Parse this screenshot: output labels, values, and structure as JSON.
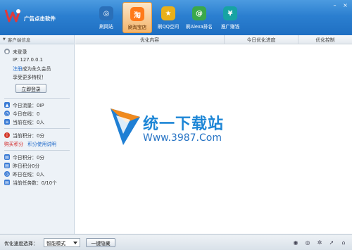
{
  "app": {
    "title": "广告点击软件"
  },
  "nav": [
    {
      "label": "刷网站",
      "icon": "globe-icon",
      "color": "#2a6fb8",
      "glyph": "◎"
    },
    {
      "label": "刷淘宝店",
      "icon": "taobao-icon",
      "color": "#ff7a1a",
      "glyph": "淘"
    },
    {
      "label": "刷QQ空间",
      "icon": "star-icon",
      "color": "#e9b019",
      "glyph": "★"
    },
    {
      "label": "刷Alexa排名",
      "icon": "at-sign-icon",
      "color": "#3aa84a",
      "glyph": "@"
    },
    {
      "label": "推广赚钱",
      "icon": "money-icon",
      "color": "#17a3a3",
      "glyph": "¥"
    }
  ],
  "window": {
    "minimize": "–",
    "close": "×"
  },
  "sidebar": {
    "header": "客户端信息",
    "status": "未登录",
    "ip": "IP: 127.0.0.1",
    "register_link": "注册",
    "register_text": "成为永久会员",
    "privilege_text": "享受更多特权！",
    "login_button": "立即登录",
    "stats1": [
      {
        "icon": "thumb-up-icon",
        "color": "#3a7bd5",
        "text": "今日流量：0IP"
      },
      {
        "icon": "alarm-clock-icon",
        "color": "#3a7bd5",
        "text": "今日在线：0"
      },
      {
        "icon": "users-icon",
        "color": "#3a7bd5",
        "text": "当前在线：0人"
      }
    ],
    "points": {
      "icon": "info-icon",
      "color": "#d33a2c",
      "text": "当前积分：0分"
    },
    "buy_points": "购买积分",
    "points_help": "积分使用说明",
    "stats2": [
      {
        "icon": "chart-icon",
        "color": "#3a7bd5",
        "text": "今日积分：0分"
      },
      {
        "icon": "chart-icon",
        "color": "#3a7bd5",
        "text": "昨日积分0分"
      },
      {
        "icon": "alarm-clock-icon",
        "color": "#3a7bd5",
        "text": "昨日在线：0人"
      },
      {
        "icon": "chart-icon",
        "color": "#3a7bd5",
        "text": "当前任务数：0/10个"
      }
    ]
  },
  "table": {
    "columns": [
      "优化内容",
      "今日优化进度",
      "优化控制"
    ]
  },
  "watermark": {
    "text": "统一下载站",
    "url": "Www.3987.Com"
  },
  "bottom": {
    "speed_label": "优化速度选择：",
    "speed_value": "智能模式",
    "hide_button": "一键隐藏",
    "icons": [
      "qq-icon",
      "eye-icon",
      "settings-icon",
      "rocket-icon",
      "home-icon"
    ]
  }
}
